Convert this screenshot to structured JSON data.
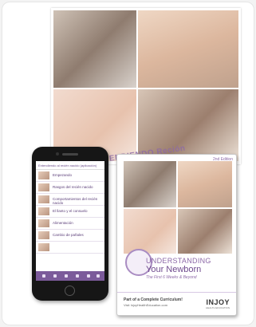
{
  "cover": {
    "band_text": "ENDIENDO\nReción"
  },
  "dvd": {
    "edition": "2nd Edition",
    "title_line1": "UNDERSTANDING",
    "title_line2": "Your Newborn",
    "title_line3": "The First 6 Weeks & Beyond",
    "curriculum": "Part of a Complete Curriculum!",
    "url": "Visit InjoyHealthEducation.com",
    "brand": "INJOY",
    "brand_sub": "HEALTH EDUCATION"
  },
  "phone": {
    "header": "Entendiendo al recién nacido (aplicación)",
    "items": [
      {
        "label": "Empezando"
      },
      {
        "label": "Rasgos del recién nacido"
      },
      {
        "label": "Comportamientos del recién nacido"
      },
      {
        "label": "El llanto y el consuelo"
      },
      {
        "label": "Alimentación"
      },
      {
        "label": "Cambio de pañales"
      },
      {
        "label": ""
      }
    ]
  },
  "colors": {
    "accent": "#8d69a8",
    "accent_dark": "#6f4a8e",
    "nav": "#7b5a9a"
  }
}
